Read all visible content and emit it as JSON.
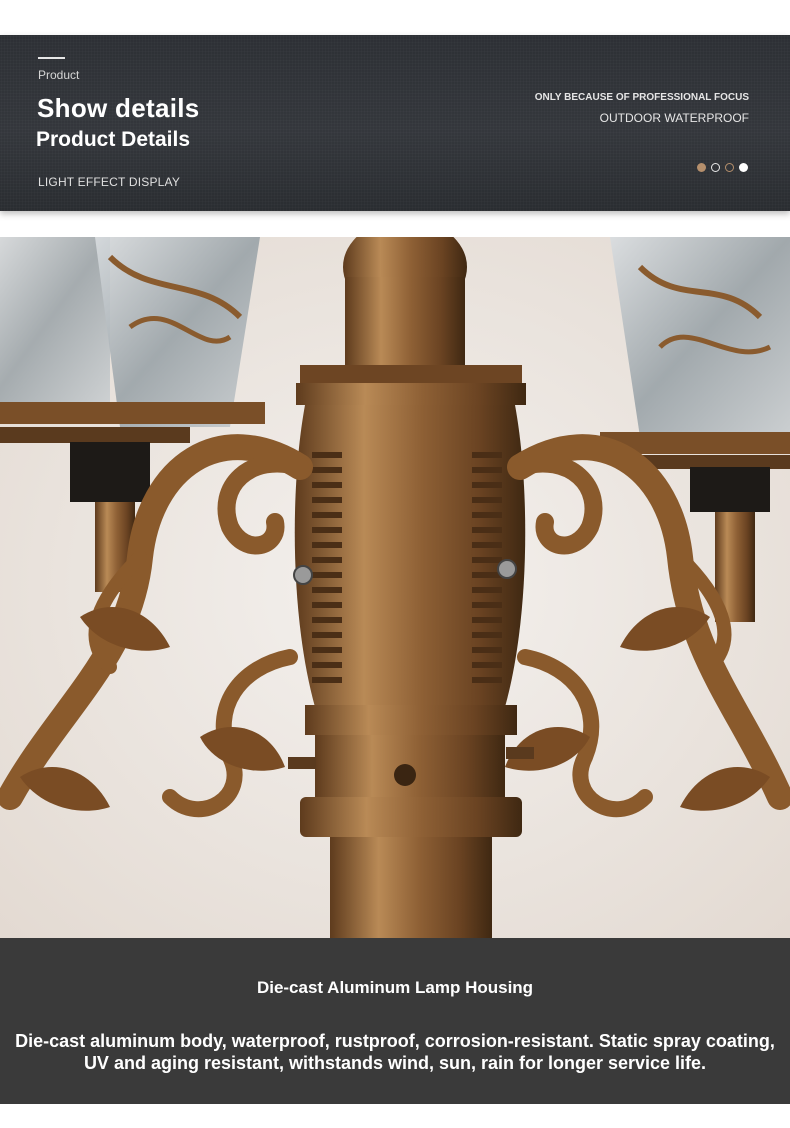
{
  "header": {
    "eyebrow": "Product",
    "title": "Show  details",
    "subtitle": "Product Details",
    "caption": "LIGHT EFFECT DISPLAY",
    "right_line1": "ONLY BECAUSE OF PROFESSIONAL FOCUS",
    "right_line2": "OUTDOOR WATERPROOF",
    "dot_colors": [
      "#b58f6c",
      "#e8e8e8",
      "#b58f6c",
      "#ffffff"
    ]
  },
  "photo": {
    "subject": "bronze-lamp-post-detail-photo"
  },
  "footer": {
    "title": "Die-cast Aluminum Lamp Housing",
    "body": "Die-cast aluminum body, waterproof, rustproof, corrosion-resistant. Static spray coating, UV and aging resistant, withstands wind, sun, rain for longer service life."
  },
  "colors": {
    "header_bg": "#303338",
    "footer_bg": "#3a3a3a",
    "bronze": "#9c6a3a"
  }
}
